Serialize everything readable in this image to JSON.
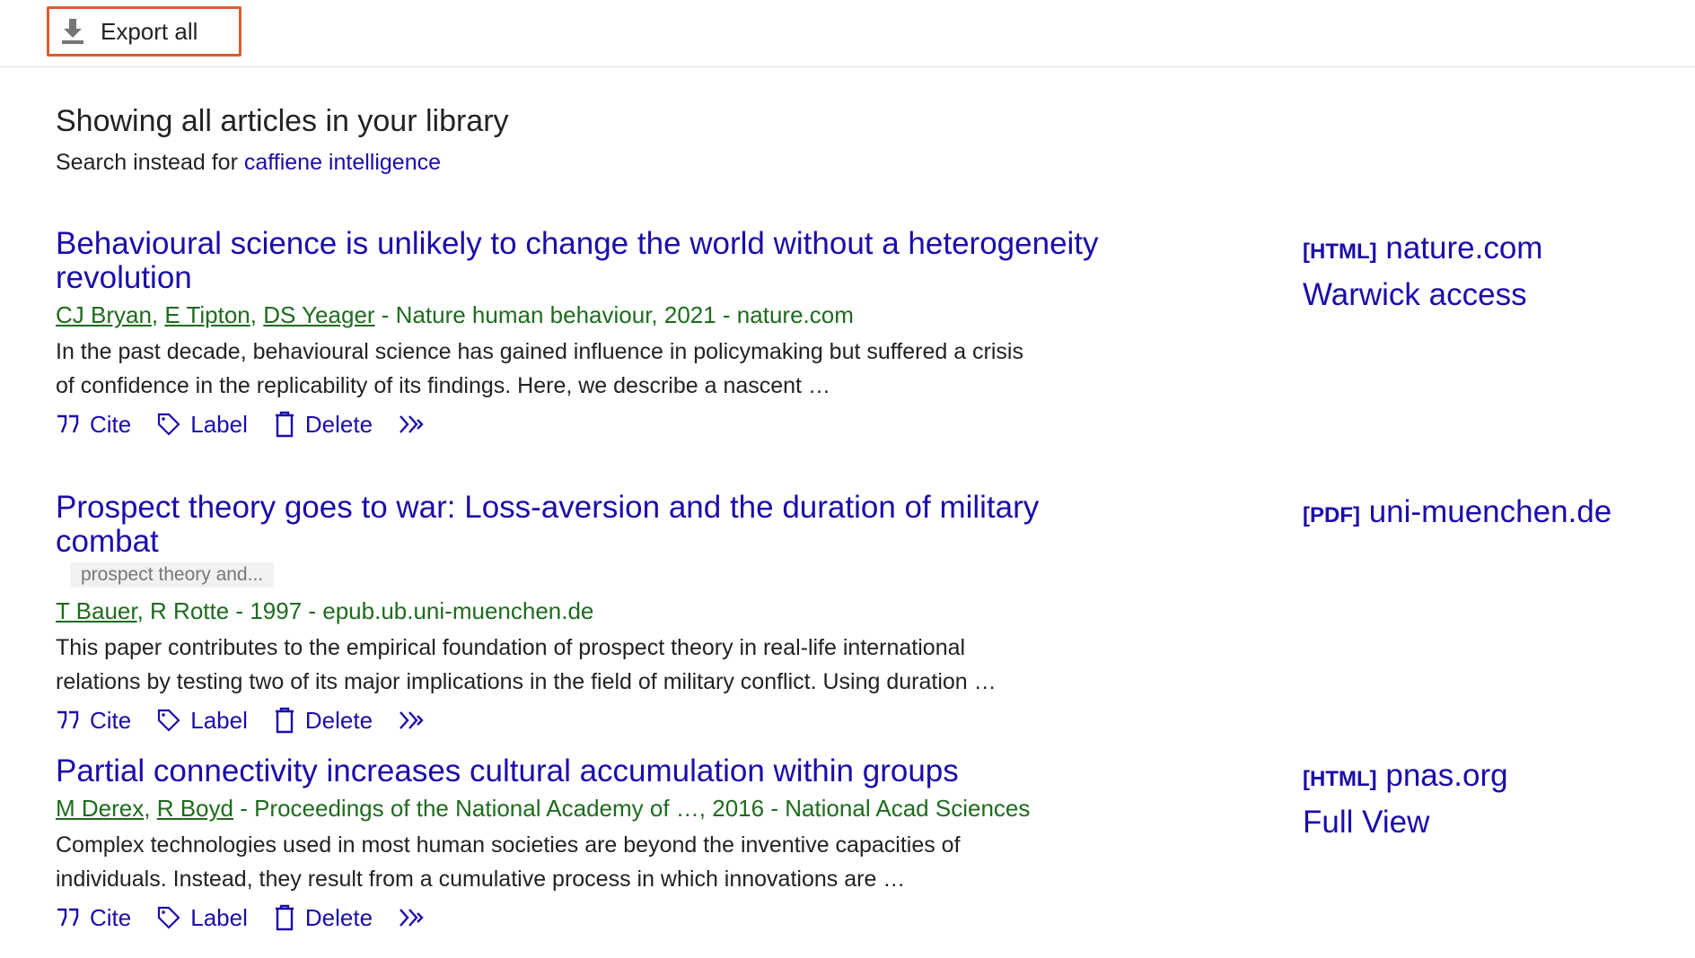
{
  "toolbar": {
    "export_label": "Export all",
    "export_icon": "download-icon"
  },
  "heading": "Showing all articles in your library",
  "search_instead": {
    "prefix": "Search instead for",
    "query": "caffiene intelligence"
  },
  "actions": {
    "cite": "Cite",
    "label": "Label",
    "delete": "Delete"
  },
  "results": [
    {
      "title": "Behavioural science is unlikely to change the world without a heterogeneity revolution",
      "authors": [
        "CJ Bryan",
        "E Tipton",
        "DS Yeager"
      ],
      "meta": "Nature human behaviour, 2021 - nature.com",
      "snippet": "In the past decade, behavioural science has gained influence in policymaking but suffered a crisis of confidence in the replicability of its findings. Here, we describe a nascent …",
      "side": [
        {
          "format": "[HTML]",
          "text": "nature.com"
        },
        {
          "format": "",
          "text": "Warwick access"
        }
      ]
    },
    {
      "title": "Prospect theory goes to war: Loss-aversion and the duration of military combat",
      "tag": "prospect theory and...",
      "authors": [
        "T Bauer"
      ],
      "authors_plain": "R Rotte",
      "meta": "1997 - epub.ub.uni-muenchen.de",
      "snippet": "This paper contributes to the empirical foundation of prospect theory in real-life international relations by testing two of its major implications in the field of military conflict. Using duration …",
      "side": [
        {
          "format": "[PDF]",
          "text": "uni-muenchen.de"
        }
      ]
    },
    {
      "title": "Partial connectivity increases cultural accumulation within groups",
      "authors": [
        "M Derex",
        "R Boyd"
      ],
      "meta": "Proceedings of the National Academy of …, 2016 - National Acad Sciences",
      "snippet": "Complex technologies used in most human societies are beyond the inventive capacities of individuals. Instead, they result from a cumulative process in which innovations are …",
      "side": [
        {
          "format": "[HTML]",
          "text": "pnas.org"
        },
        {
          "format": "",
          "text": "Full View"
        }
      ]
    }
  ],
  "colors": {
    "link": "#1a0dab",
    "meta": "#1e6b1e",
    "highlight_border": "#e05a2b"
  }
}
